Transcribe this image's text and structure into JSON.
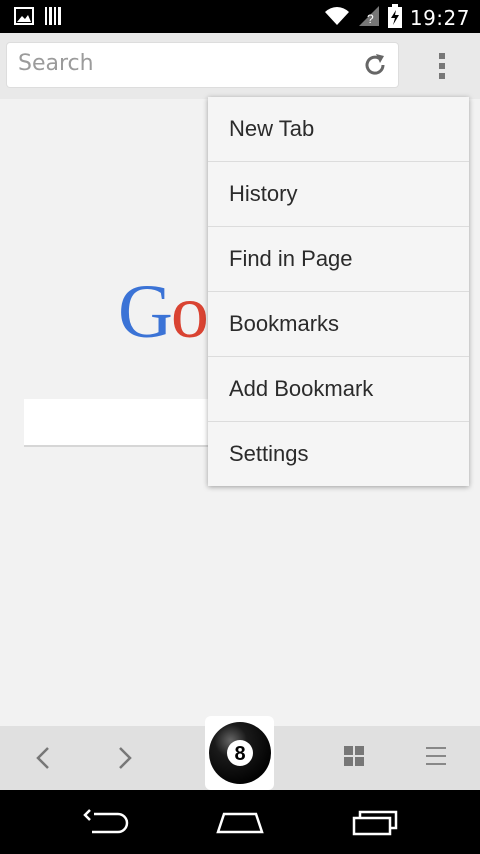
{
  "status_bar": {
    "time": "19:27",
    "left_icons": [
      "image-icon",
      "barcode-icon"
    ],
    "right_icons": [
      "wifi-icon",
      "signal-icon",
      "battery-charging-icon"
    ]
  },
  "toolbar": {
    "search_placeholder": "Search",
    "reload_icon": "reload-icon",
    "overflow_icon": "overflow-menu-icon"
  },
  "page": {
    "logo_visible_text": [
      "G",
      "o"
    ]
  },
  "menu": {
    "items": [
      {
        "label": "New Tab"
      },
      {
        "label": "History"
      },
      {
        "label": "Find in Page"
      },
      {
        "label": "Bookmarks"
      },
      {
        "label": "Add Bookmark"
      },
      {
        "label": "Settings"
      }
    ]
  },
  "bottom_toolbar": {
    "icons": [
      "back-icon",
      "forward-icon",
      "eight-ball-icon",
      "tabs-grid-icon",
      "list-menu-icon"
    ],
    "eight_ball_label": "8"
  },
  "nav_bar": {
    "icons": [
      "nav-back-icon",
      "nav-home-icon",
      "nav-recents-icon"
    ]
  },
  "colors": {
    "google_blue": "#3b73d6",
    "google_red": "#d94332",
    "menu_bg": "#f5f5f5"
  }
}
